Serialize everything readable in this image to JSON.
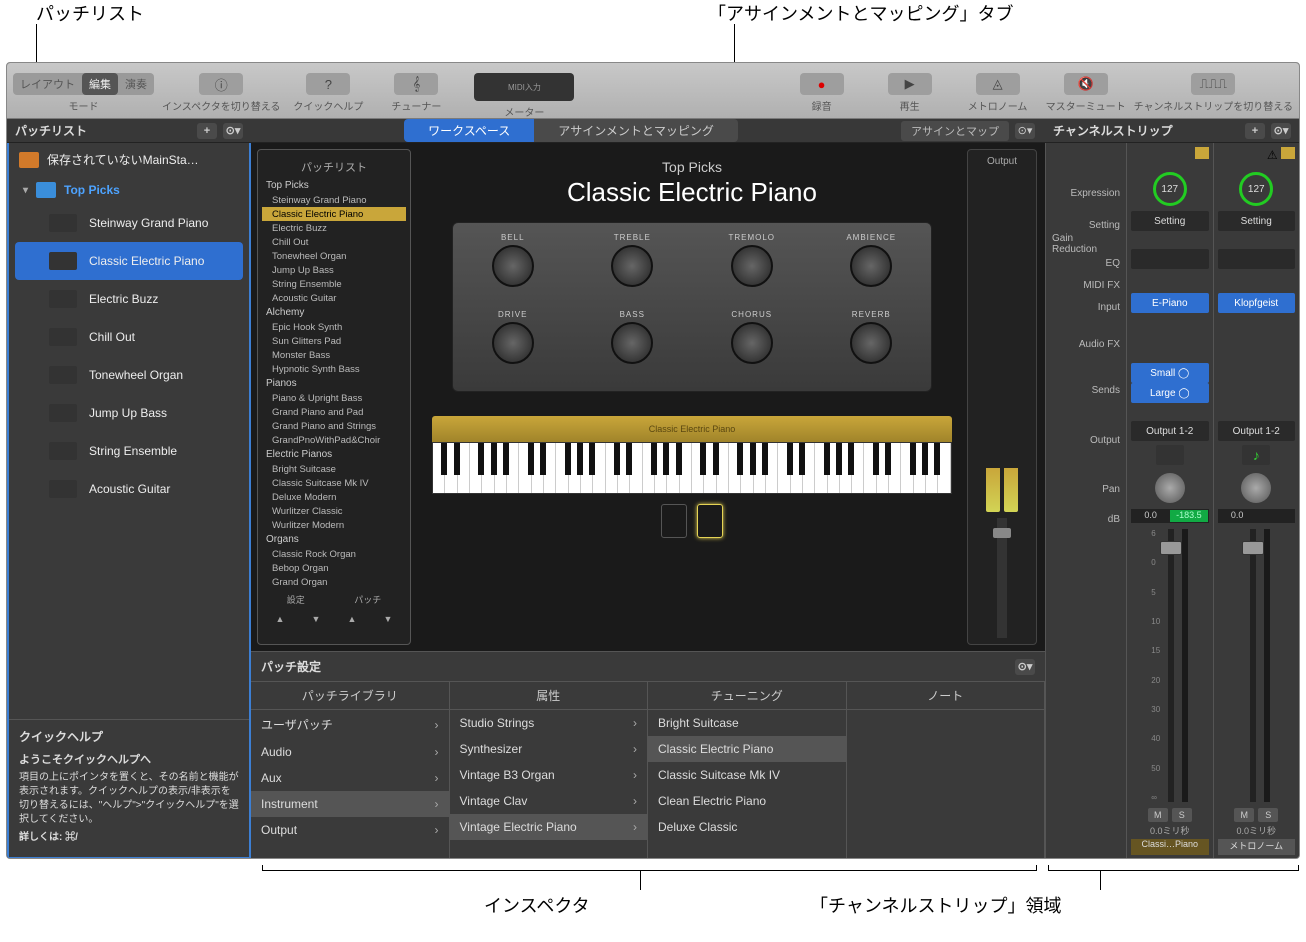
{
  "callouts": {
    "patch_list": "パッチリスト",
    "assign_tab": "「アサインメントとマッピング」タブ",
    "inspector": "インスペクタ",
    "channel_area": "「チャンネルストリップ」領域"
  },
  "toolbar": {
    "mode_label": "モード",
    "modes": [
      "レイアウト",
      "編集",
      "演奏"
    ],
    "active_mode": 1,
    "inspector_toggle": "インスペクタを切り替える",
    "quick_help": "クイックヘルプ",
    "tuner": "チューナー",
    "midi_in": "MIDI入力",
    "meter": "メーター",
    "record": "録音",
    "play": "再生",
    "metronome": "メトロノーム",
    "master_mute": "マスターミュート",
    "chstrip_toggle": "チャンネルストリップを切り替える"
  },
  "tabrow": {
    "patch_list": "パッチリスト",
    "workspace": "ワークスペース",
    "assign_map": "アサインメントとマッピング",
    "assign_short": "アサインとマップ",
    "channel_strip": "チャンネルストリップ"
  },
  "sidebar": {
    "concert": "保存されていないMainSta…",
    "set_name": "Top Picks",
    "patches": [
      "Steinway Grand Piano",
      "Classic Electric Piano",
      "Electric Buzz",
      "Chill Out",
      "Tonewheel Organ",
      "Jump Up Bass",
      "String Ensemble",
      "Acoustic Guitar"
    ],
    "selected": 1
  },
  "quick_help": {
    "header": "クイックヘルプ",
    "title": "ようこそクイックヘルプへ",
    "body": "項目の上にポインタを置くと、その名前と機能が表示されます。クイックヘルプの表示/非表示を切り替えるには、\"ヘルプ\">\"クイックヘルプ\"を選択してください。",
    "more": "詳しくは: ⌘/"
  },
  "workspace": {
    "patchlist_head": "パッチリスト",
    "groups": [
      {
        "name": "Top Picks",
        "items": [
          "Steinway Grand Piano",
          "Classic Electric Piano",
          "Electric Buzz",
          "Chill Out",
          "Tonewheel Organ",
          "Jump Up Bass",
          "String Ensemble",
          "Acoustic Guitar"
        ]
      },
      {
        "name": "Alchemy",
        "items": [
          "Epic Hook Synth",
          "Sun Glitters Pad",
          "Monster Bass",
          "Hypnotic Synth Bass"
        ]
      },
      {
        "name": "Pianos",
        "items": [
          "Piano & Upright Bass",
          "Grand Piano and Pad",
          "Grand Piano and Strings",
          "GrandPnoWithPad&Choir"
        ]
      },
      {
        "name": "Electric Pianos",
        "items": [
          "Bright Suitcase",
          "Classic Suitcase Mk IV",
          "Deluxe Modern",
          "Wurlitzer Classic",
          "Wurlitzer Modern"
        ]
      },
      {
        "name": "Organs",
        "items": [
          "Classic Rock Organ",
          "Bebop Organ",
          "Grand Organ"
        ]
      }
    ],
    "nav": {
      "set": "設定",
      "patch": "パッチ"
    },
    "title_sm": "Top Picks",
    "title": "Classic Electric Piano",
    "knobs": [
      "BELL",
      "TREBLE",
      "TREMOLO",
      "AMBIENCE",
      "DRIVE",
      "BASS",
      "CHORUS",
      "REVERB"
    ],
    "kbd_label": "Classic Electric Piano",
    "output": "Output"
  },
  "inspector": {
    "head": "パッチ設定",
    "tabs": [
      "パッチライブラリ",
      "属性",
      "チューニング",
      "ノート"
    ],
    "col1": [
      "ユーザパッチ",
      "Audio",
      "Aux",
      "Instrument",
      "Output"
    ],
    "col1_sel": 3,
    "col2": [
      "Studio Strings",
      "Synthesizer",
      "Vintage B3 Organ",
      "Vintage Clav",
      "Vintage Electric Piano"
    ],
    "col2_sel": 4,
    "col3": [
      "Bright Suitcase",
      "Classic Electric Piano",
      "Classic Suitcase Mk IV",
      "Clean Electric Piano",
      "Deluxe Classic"
    ],
    "col3_sel": 1
  },
  "channel": {
    "labels": [
      "Expression",
      "Setting",
      "Gain Reduction",
      "EQ",
      "MIDI FX",
      "Input",
      "Audio FX",
      "Sends",
      "Output",
      "Pan",
      "dB"
    ],
    "strips": [
      {
        "setting": "Setting",
        "input": "E-Piano",
        "sends": [
          "Small",
          "Large"
        ],
        "output": "Output 1-2",
        "db": "0.0",
        "peak": "-183.5",
        "ms": "0.0ミリ秒",
        "name": "Classi…Piano",
        "val": "127",
        "icon": "inst"
      },
      {
        "setting": "Setting",
        "input": "Klopfgeist",
        "sends": [],
        "output": "Output 1-2",
        "db": "0.0",
        "peak": "",
        "ms": "0.0ミリ秒",
        "name": "メトロノーム",
        "val": "127",
        "icon": "green"
      }
    ],
    "mute": "M",
    "solo": "S",
    "scale": [
      "6",
      "0",
      "5",
      "10",
      "15",
      "20",
      "30",
      "40",
      "50",
      "∞"
    ]
  }
}
